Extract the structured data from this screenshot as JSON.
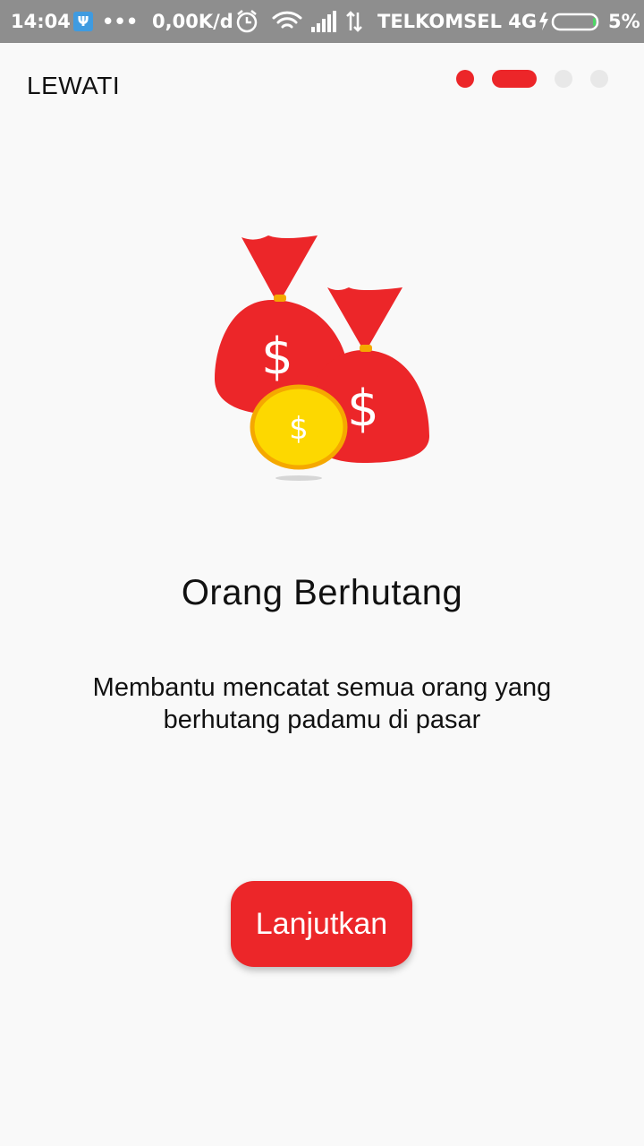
{
  "status_bar": {
    "time": "14:04",
    "usb_symbol": "Ψ",
    "dots": "•••",
    "speed": "0,00K/d",
    "carrier": "TELKOMSEL 4G",
    "battery_percent": "5%",
    "battery_level": 0.05,
    "icons": [
      "usb-icon",
      "alarm-icon",
      "wifi-icon",
      "signal-icon",
      "data-arrows-icon",
      "charging-icon",
      "battery-icon"
    ]
  },
  "onboarding": {
    "skip_label": "LEWATI",
    "page_indicator": {
      "total": 4,
      "current": 2
    },
    "illustration": "money-bags-icon",
    "bag_symbol": "$",
    "coin_symbol": "$",
    "title": "Orang Berhutang",
    "description": "Membantu mencatat semua orang yang berhutang padamu di pasar",
    "continue_label": "Lanjutkan"
  },
  "colors": {
    "accent": "#ec2629",
    "coin": "#fdd800",
    "coin_rim": "#f5a800",
    "dot_inactive": "#e8e8e8",
    "background": "#f9f9f9",
    "status_bar": "#8e8e8e"
  }
}
